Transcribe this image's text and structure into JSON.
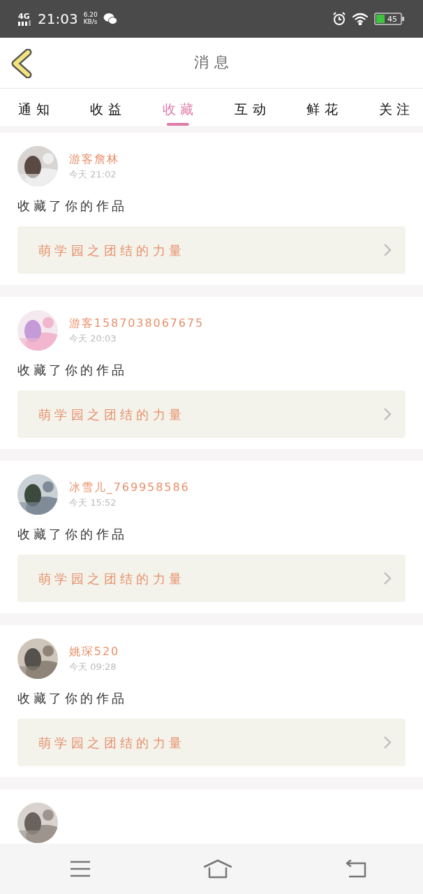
{
  "status_bar": {
    "network": "4G",
    "time": "21:03",
    "speed_value": "6.20",
    "speed_unit": "KB/s",
    "battery": "45"
  },
  "header": {
    "title": "消息"
  },
  "tabs": [
    {
      "label": "通知",
      "selected": false
    },
    {
      "label": "收益",
      "selected": false
    },
    {
      "label": "收藏",
      "selected": true
    },
    {
      "label": "互动",
      "selected": false
    },
    {
      "label": "鲜花",
      "selected": false
    },
    {
      "label": "关注",
      "selected": false
    }
  ],
  "messages": [
    {
      "name": "游客詹林",
      "time": "今天 21:02",
      "text": "收藏了你的作品",
      "work": "萌学园之团结的力量"
    },
    {
      "name": "游客1587038067675",
      "time": "今天 20:03",
      "text": "收藏了你的作品",
      "work": "萌学园之团结的力量"
    },
    {
      "name": "冰雪儿_769958586",
      "time": "今天 15:52",
      "text": "收藏了你的作品",
      "work": "萌学园之团结的力量"
    },
    {
      "name": "姚琛520",
      "time": "今天 09:28",
      "text": "收藏了你的作品",
      "work": "萌学园之团结的力量"
    }
  ]
}
